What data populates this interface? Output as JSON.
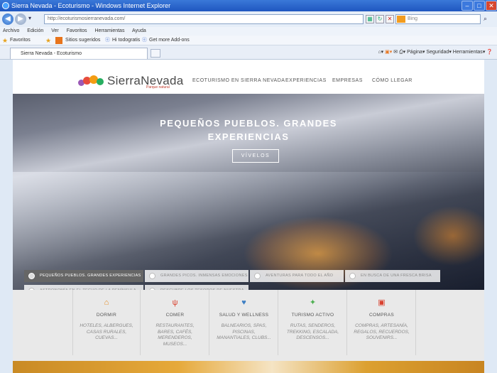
{
  "browser": {
    "title": "Sierra Nevada - Ecoturismo - Windows Internet Explorer",
    "url": "http://ecoturismosierranevada.com/",
    "search_placeholder": "Bing",
    "menu": [
      "Archivo",
      "Edición",
      "Ver",
      "Favoritos",
      "Herramientas",
      "Ayuda"
    ],
    "favorites_label": "Favoritos",
    "favorites_items": [
      "Sitios sugeridos",
      "Hi todogratis",
      "Get more Add-ons"
    ],
    "tab_title": "Sierra Nevada - Ecoturismo",
    "tools": [
      "Página",
      "Seguridad",
      "Herramientas"
    ]
  },
  "site": {
    "logo_text": "SierraNevada",
    "logo_tagline": "Parque natural",
    "nav": [
      "ECOTURISMO EN SIERRA NEVADA",
      "EXPERIENCIAS",
      "EMPRESAS",
      "CÓMO LLEGAR"
    ],
    "hero_title_line1": "PEQUEÑOS PUEBLOS. GRANDES",
    "hero_title_line2": "EXPERIENCIAS",
    "hero_button": "VÍVELOS",
    "pills": [
      "PEQUEÑOS PUEBLOS. GRANDES EXPERIENCIAS",
      "GRANDES PICOS. INMENSAS EMOCIONES",
      "AVENTURAS PARA TODO EL AÑO",
      "EN BUSCA DE UNA FRESCA BRISA",
      "ASTRONOMÍA EN EL TECHO DE LA PENÍNSULA",
      "DESCUBRE LOS TESOROS DE NUESTRA"
    ],
    "categories": [
      {
        "icon": "house-icon",
        "title": "DORMIR",
        "desc": "HOTELES, ALBERGUES, CASAS RURALES, CUEVAS..."
      },
      {
        "icon": "fork-knife-icon",
        "title": "COMER",
        "desc": "RESTAURANTES, BARES, CAFÉS, MERENDEROS, MUSEOS..."
      },
      {
        "icon": "heart-icon",
        "title": "SALUD Y WELLNESS",
        "desc": "BALNEARIOS, SPAS, PISCINAS, MANANTIALES, CLUBS..."
      },
      {
        "icon": "hiker-icon",
        "title": "TURISMO ACTIVO",
        "desc": "RUTAS, SENDEROS, TREKKING, ESCALADA, DESCENSOS..."
      },
      {
        "icon": "gift-icon",
        "title": "COMPRAS",
        "desc": "COMPRAS, ARTESANÍA, REGALOS, RECUERDOS, SOUVENIRS..."
      }
    ],
    "colors": {
      "accent": "#e58a1f",
      "heart": "#3d7fc4",
      "hiker": "#4caf50",
      "gift": "#d9412e"
    }
  }
}
